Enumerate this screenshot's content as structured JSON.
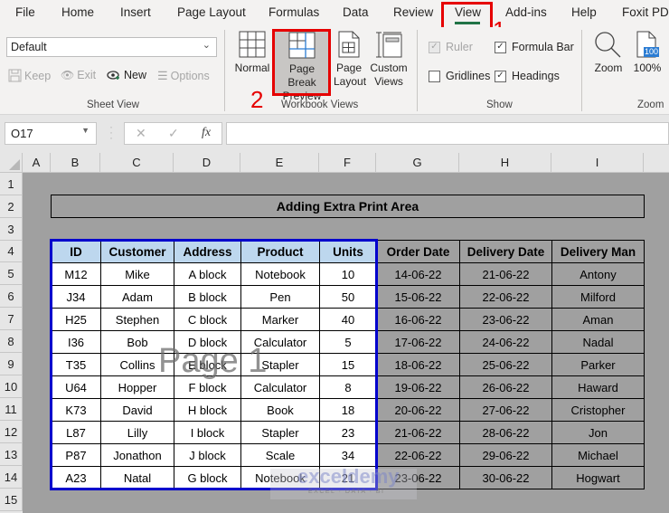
{
  "menu": {
    "tabs": [
      "File",
      "Home",
      "Insert",
      "Page Layout",
      "Formulas",
      "Data",
      "Review",
      "View",
      "Add-ins",
      "Help",
      "Foxit PDF"
    ],
    "active_tab": "View"
  },
  "annotations": {
    "step1": "1",
    "step2": "2"
  },
  "ribbon": {
    "sheet_view": {
      "select_value": "Default",
      "keep": "Keep",
      "exit": "Exit",
      "new": "New",
      "options": "Options",
      "label": "Sheet View"
    },
    "workbook_views": {
      "normal": "Normal",
      "page_break_line1": "Page Break",
      "page_break_line2": "Preview",
      "page_layout_line1": "Page",
      "page_layout_line2": "Layout",
      "custom_line1": "Custom",
      "custom_line2": "Views",
      "label": "Workbook Views"
    },
    "show": {
      "ruler": "Ruler",
      "formula_bar": "Formula Bar",
      "gridlines": "Gridlines",
      "headings": "Headings",
      "label": "Show"
    },
    "zoom": {
      "zoom": "Zoom",
      "hundred": "100%",
      "badge": "100",
      "label": "Zoom"
    }
  },
  "formula_bar": {
    "name_box": "O17",
    "cancel_icon": "✕",
    "enter_icon": "✓",
    "fx": "fx",
    "value": ""
  },
  "columns": [
    "A",
    "B",
    "C",
    "D",
    "E",
    "F",
    "G",
    "H",
    "I"
  ],
  "rows": [
    "1",
    "2",
    "3",
    "4",
    "5",
    "6",
    "7",
    "8",
    "9",
    "10",
    "11",
    "12",
    "13",
    "14",
    "15"
  ],
  "sheet": {
    "title": "Adding Extra Print Area",
    "headers": [
      "ID",
      "Customer",
      "Address",
      "Product",
      "Units",
      "Order Date",
      "Delivery Date",
      "Delivery Man"
    ],
    "data": [
      [
        "M12",
        "Mike",
        "A block",
        "Notebook",
        "10",
        "14-06-22",
        "21-06-22",
        "Antony"
      ],
      [
        "J34",
        "Adam",
        "B block",
        "Pen",
        "50",
        "15-06-22",
        "22-06-22",
        "Milford"
      ],
      [
        "H25",
        "Stephen",
        "C block",
        "Marker",
        "40",
        "16-06-22",
        "23-06-22",
        "Aman"
      ],
      [
        "I36",
        "Bob",
        "D block",
        "Calculator",
        "5",
        "17-06-22",
        "24-06-22",
        "Nadal"
      ],
      [
        "T35",
        "Collins",
        "E block",
        "Stapler",
        "15",
        "18-06-22",
        "25-06-22",
        "Parker"
      ],
      [
        "U64",
        "Hopper",
        "F block",
        "Calculator",
        "8",
        "19-06-22",
        "26-06-22",
        "Haward"
      ],
      [
        "K73",
        "David",
        "H block",
        "Book",
        "18",
        "20-06-22",
        "27-06-22",
        "Cristopher"
      ],
      [
        "L87",
        "Lilly",
        "I block",
        "Stapler",
        "23",
        "21-06-22",
        "28-06-22",
        "Jon"
      ],
      [
        "P87",
        "Jonathon",
        "J block",
        "Scale",
        "34",
        "22-06-22",
        "29-06-22",
        "Michael"
      ],
      [
        "A23",
        "Natal",
        "G block",
        "Notebook",
        "21",
        "23-06-22",
        "30-06-22",
        "Hogwart"
      ]
    ],
    "page_watermark": "Page 1"
  },
  "watermark": {
    "brand": "exceldemy",
    "tagline": "EXCEL · DATA · BI"
  },
  "colors": {
    "accent": "#217346",
    "annotation": "#e60000",
    "print_area": "#0000cc",
    "header_fill": "#bdd7ee",
    "outside_print": "#a0a0a0"
  }
}
